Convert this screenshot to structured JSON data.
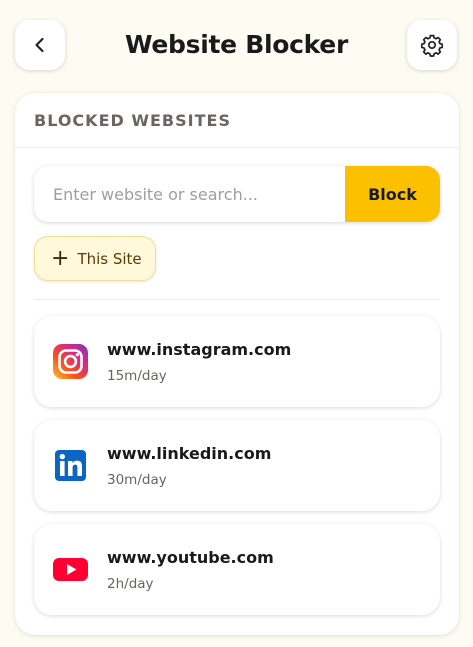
{
  "header": {
    "title": "Website Blocker",
    "back_icon": "chevron-left-icon",
    "settings_icon": "gear-icon"
  },
  "section": {
    "title": "BLOCKED WEBSITES"
  },
  "search": {
    "placeholder": "Enter website or search...",
    "value": "",
    "button_label": "Block"
  },
  "this_site": {
    "label": "This Site"
  },
  "sites": [
    {
      "domain": "www.instagram.com",
      "limit": "15m/day",
      "icon": "instagram-icon"
    },
    {
      "domain": "www.linkedin.com",
      "limit": "30m/day",
      "icon": "linkedin-icon"
    },
    {
      "domain": "www.youtube.com",
      "limit": "2h/day",
      "icon": "youtube-icon"
    }
  ],
  "colors": {
    "background": "#fdfcf2",
    "accent": "#fbc000",
    "this_site_bg": "#fff8db",
    "muted_text": "#6b6460"
  }
}
